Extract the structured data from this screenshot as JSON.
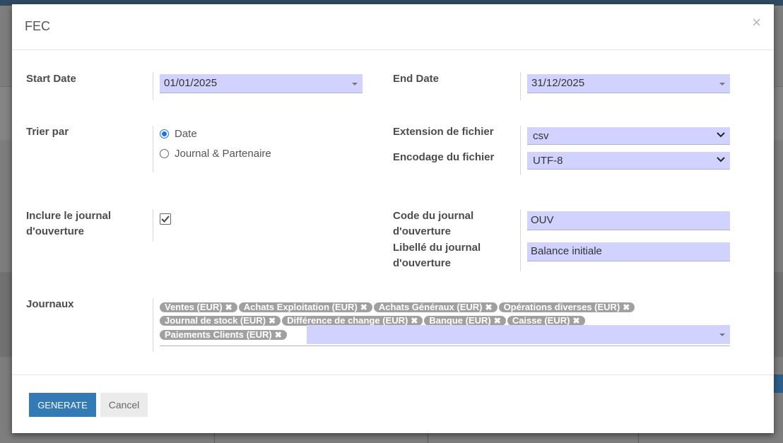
{
  "dialog": {
    "title": "FEC",
    "close_label": "×"
  },
  "form": {
    "start_date": {
      "label": "Start Date",
      "value": "01/01/2025"
    },
    "end_date": {
      "label": "End Date",
      "value": "31/12/2025"
    },
    "sort": {
      "label": "Trier par",
      "options": [
        "Date",
        "Journal & Partenaire"
      ],
      "selected": "Date"
    },
    "file_extension": {
      "label": "Extension de fichier",
      "value": "csv"
    },
    "file_encoding": {
      "label": "Encodage du fichier",
      "value": "UTF-8"
    },
    "include_opening": {
      "label_line1": "Inclure le journal",
      "label_line2": "d'ouverture",
      "checked": true
    },
    "opening_code": {
      "label_line1": "Code du journal",
      "label_line2": "d'ouverture",
      "value": "OUV"
    },
    "opening_label": {
      "label_line1": "Libellé du journal",
      "label_line2": "d'ouverture",
      "value": "Balance initiale"
    },
    "journals": {
      "label": "Journaux",
      "tags": [
        "Ventes (EUR)",
        "Achats Exploitation (EUR)",
        "Achats Généraux (EUR)",
        "Opérations diverses (EUR)",
        "Journal de stock (EUR)",
        "Différence de change (EUR)",
        "Banque (EUR)",
        "Caisse (EUR)",
        "Paiements Clients (EUR)"
      ]
    }
  },
  "footer": {
    "generate_label": "GENERATE",
    "cancel_label": "Cancel"
  },
  "icons": {
    "tag_remove": "✖",
    "check": "check-icon"
  },
  "colors": {
    "input_bg": "#d2d2ff",
    "primary": "#337ab7",
    "tag_bg": "#a0a0a0"
  }
}
